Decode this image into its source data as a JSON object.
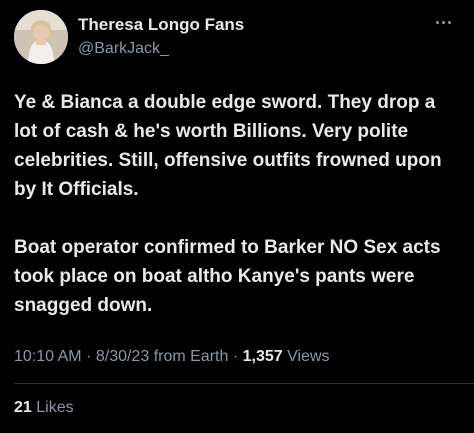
{
  "author": {
    "display_name": "Theresa Longo Fans",
    "handle": "@BarkJack_",
    "avatar_icon": "profile-photo"
  },
  "tweet": {
    "paragraphs": [
      "Ye & Bianca a double edge sword. They drop a lot of cash & he's worth Billions. Very polite celebrities. Still, offensive outfits frowned upon by It Officials.",
      "Boat operator confirmed to Barker NO Sex acts took place on boat altho Kanye's pants were snagged down."
    ]
  },
  "meta": {
    "time": "10:10 AM",
    "separator": "·",
    "date": "8/30/23",
    "source": "from Earth",
    "views_count": "1,357",
    "views_label": "Views"
  },
  "engagement": {
    "likes_count": "21",
    "likes_label": "Likes"
  },
  "colors": {
    "background": "#000000",
    "primary_text": "#e7e9ea",
    "secondary_text": "#8b98a5",
    "divider": "#2f3336"
  }
}
